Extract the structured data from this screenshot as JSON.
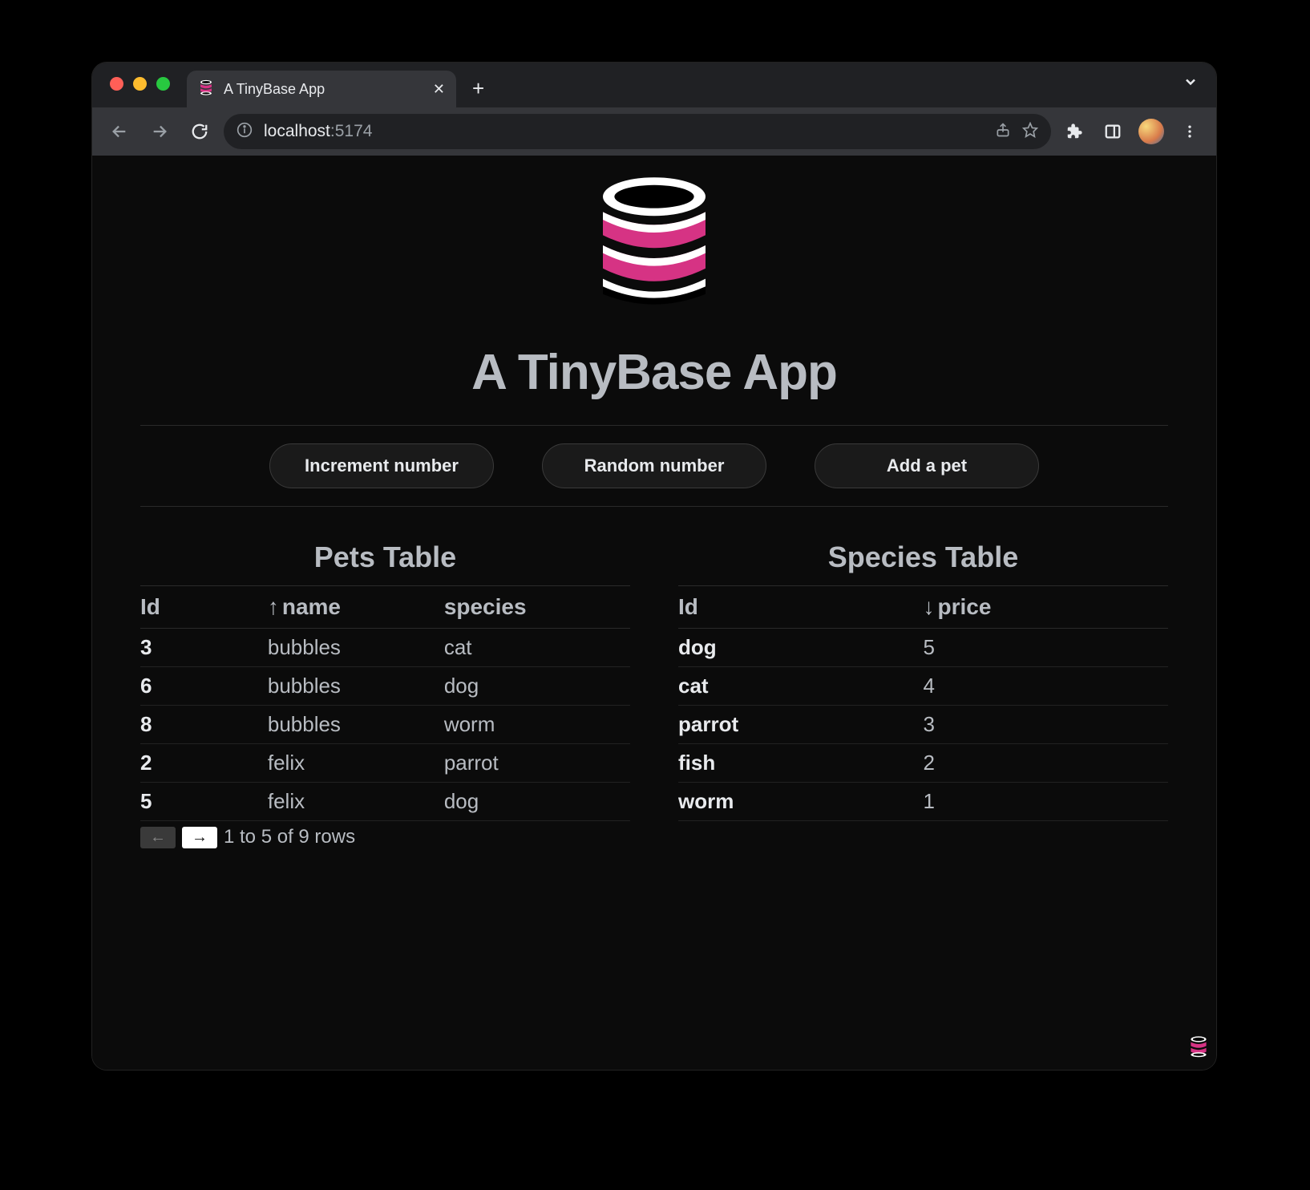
{
  "browser": {
    "tab_title": "A TinyBase App",
    "url_host": "localhost",
    "url_port": ":5174"
  },
  "app": {
    "title": "A TinyBase App"
  },
  "buttons": {
    "increment": "Increment number",
    "random": "Random number",
    "addpet": "Add a pet"
  },
  "pets": {
    "title": "Pets Table",
    "headers": {
      "id": "Id",
      "name_sort": "↑",
      "name": "name",
      "species": "species"
    },
    "rows": [
      {
        "id": "3",
        "name": "bubbles",
        "species": "cat"
      },
      {
        "id": "6",
        "name": "bubbles",
        "species": "dog"
      },
      {
        "id": "8",
        "name": "bubbles",
        "species": "worm"
      },
      {
        "id": "2",
        "name": "felix",
        "species": "parrot"
      },
      {
        "id": "5",
        "name": "felix",
        "species": "dog"
      }
    ],
    "pager": {
      "prev": "←",
      "next": "→",
      "text": "1 to 5 of 9 rows"
    }
  },
  "species": {
    "title": "Species Table",
    "headers": {
      "id": "Id",
      "price_sort": "↓",
      "price": "price"
    },
    "rows": [
      {
        "id": "dog",
        "price": "5"
      },
      {
        "id": "cat",
        "price": "4"
      },
      {
        "id": "parrot",
        "price": "3"
      },
      {
        "id": "fish",
        "price": "2"
      },
      {
        "id": "worm",
        "price": "1"
      }
    ]
  }
}
